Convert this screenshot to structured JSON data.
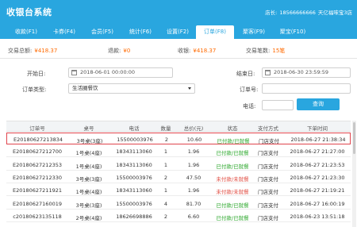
{
  "app": {
    "title": "收银台系统"
  },
  "store": {
    "manager_label": "店长:",
    "phone": "18566666666",
    "shop": "天亿福味宝3店"
  },
  "nav": {
    "tabs": [
      "收款(F1)",
      "卡券(F4)",
      "会员(F5)",
      "统计(F6)",
      "设置(F2)",
      "订单(F8)",
      "聚客(F9)",
      "聚宝(F10)"
    ],
    "active": "订单(F8)"
  },
  "stats": {
    "total_label": "交易总额:",
    "total_value": "¥418.37",
    "refund_label": "退款:",
    "refund_value": "¥0",
    "received_label": "收银:",
    "received_value": "¥418.37",
    "count_label": "交易笔数:",
    "count_value": "15笔"
  },
  "filters": {
    "start_label": "开始日:",
    "start_value": "2018-06-01 00:00:00",
    "end_label": "结束日:",
    "end_value": "2018-06-30 23:59:59",
    "type_label": "订单类型:",
    "type_value": "生活圈餐饮",
    "order_no_label": "订单号:",
    "phone_label": "电话:",
    "query_button": "查询"
  },
  "table": {
    "headers": [
      "订单号",
      "桌号",
      "电话",
      "数量",
      "总价(元)",
      "状态",
      "支付方式",
      "下单时间"
    ],
    "rows": [
      [
        "E20180627213834",
        "3号桌(3座)",
        "15500003976",
        "2",
        "10.60",
        "已付款/已就餐",
        "门店支付",
        "2018-06-27 21:38:34"
      ],
      [
        "E20180627212700",
        "1号桌(4座)",
        "18343113060",
        "1",
        "1.96",
        "已付款/已就餐",
        "门店支付",
        "2018-06-27 21:27:00"
      ],
      [
        "E20180627212353",
        "1号桌(4座)",
        "18343113060",
        "1",
        "1.96",
        "已付款/已就餐",
        "门店支付",
        "2018-06-27 21:23:53"
      ],
      [
        "E20180627212330",
        "3号桌(3座)",
        "15500003976",
        "2",
        "47.50",
        "未付款/未就餐",
        "门店支付",
        "2018-06-27 21:23:30"
      ],
      [
        "E20180627211921",
        "1号桌(4座)",
        "18343113060",
        "1",
        "1.96",
        "未付款/未就餐",
        "门店支付",
        "2018-06-27 21:19:21"
      ],
      [
        "E20180627160019",
        "3号桌(3座)",
        "15500003976",
        "4",
        "81.70",
        "已付款/已就餐",
        "门店支付",
        "2018-06-27 16:00:19"
      ],
      [
        "c20180623135118",
        "2号桌(4座)",
        "18626698886",
        "2",
        "6.60",
        "已付款/已就餐",
        "门店支付",
        "2018-06-23 13:51:18"
      ]
    ]
  },
  "colors": {
    "brand": "#29a6df",
    "amount": "#ff6a00",
    "paid": "#29a629",
    "unpaid": "#e04a3f",
    "selected_border": "#e0454d"
  }
}
